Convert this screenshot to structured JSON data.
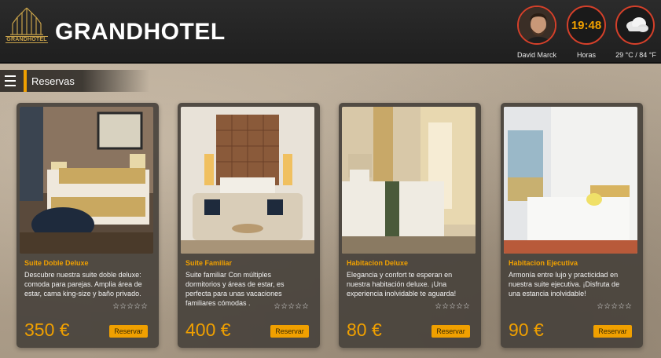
{
  "header": {
    "logo_text": "GRANDHOTEL",
    "brand": "GRANDHOTEL",
    "user_name": "David Marck",
    "clock_time": "19:48",
    "clock_label": "Horas",
    "weather_label": "29 °C / 84 °F",
    "icons": {
      "avatar": "user-avatar",
      "weather": "cloud-icon"
    }
  },
  "section": {
    "title": "Reservas",
    "menu_icon": "menu-icon"
  },
  "colors": {
    "accent": "#f0a000",
    "ring": "#d5402a",
    "header_bg": "#232323"
  },
  "rooms": [
    {
      "title": "Suite Doble Deluxe",
      "description": "Descubre nuestra suite doble deluxe: comoda para parejas. Amplia área de estar, cama king-size y baño privado.",
      "stars": "☆☆☆☆☆",
      "price": "350 €",
      "button": "Reservar"
    },
    {
      "title": "Suite Familiar",
      "description": "Suite familiar Con múltiples dormitorios y áreas de estar, es perfecta para unas vacaciones familiares cómodas .",
      "stars": "☆☆☆☆☆",
      "price": "400 €",
      "button": "Reservar"
    },
    {
      "title": "Habitacion Deluxe",
      "description": "Elegancia y confort te esperan en nuestra habitación deluxe. ¡Una experiencia inolvidable te aguarda!",
      "stars": "☆☆☆☆☆",
      "price": "80 €",
      "button": "Reservar"
    },
    {
      "title": "Habitacion Ejecutiva",
      "description": "Armonía entre lujo y practicidad en nuestra suite ejecutiva. ¡Disfruta de una estancia inolvidable!",
      "stars": "☆☆☆☆☆",
      "price": "90 €",
      "button": "Reservar"
    }
  ]
}
